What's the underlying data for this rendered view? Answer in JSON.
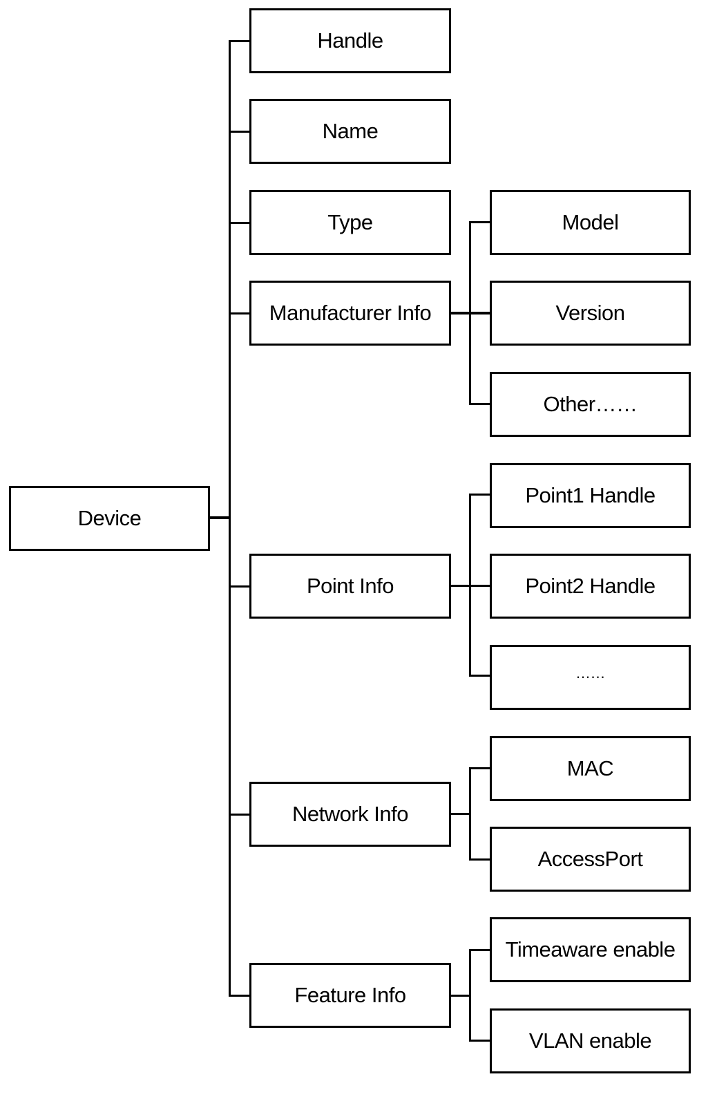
{
  "diagram": {
    "root": {
      "label": "Device"
    },
    "children": [
      {
        "label": "Handle"
      },
      {
        "label": "Name"
      },
      {
        "label": "Type"
      },
      {
        "label": "Manufacturer Info",
        "children": [
          {
            "label": "Model"
          },
          {
            "label": "Version"
          },
          {
            "label": "Other……"
          }
        ]
      },
      {
        "label": "Point Info",
        "children": [
          {
            "label": "Point1 Handle"
          },
          {
            "label": "Point2 Handle"
          },
          {
            "label": "……"
          }
        ]
      },
      {
        "label": "Network Info",
        "children": [
          {
            "label": "MAC"
          },
          {
            "label": "AccessPort"
          }
        ]
      },
      {
        "label": "Feature Info",
        "children": [
          {
            "label": "Timeaware enable"
          },
          {
            "label": "VLAN enable"
          }
        ]
      }
    ]
  }
}
